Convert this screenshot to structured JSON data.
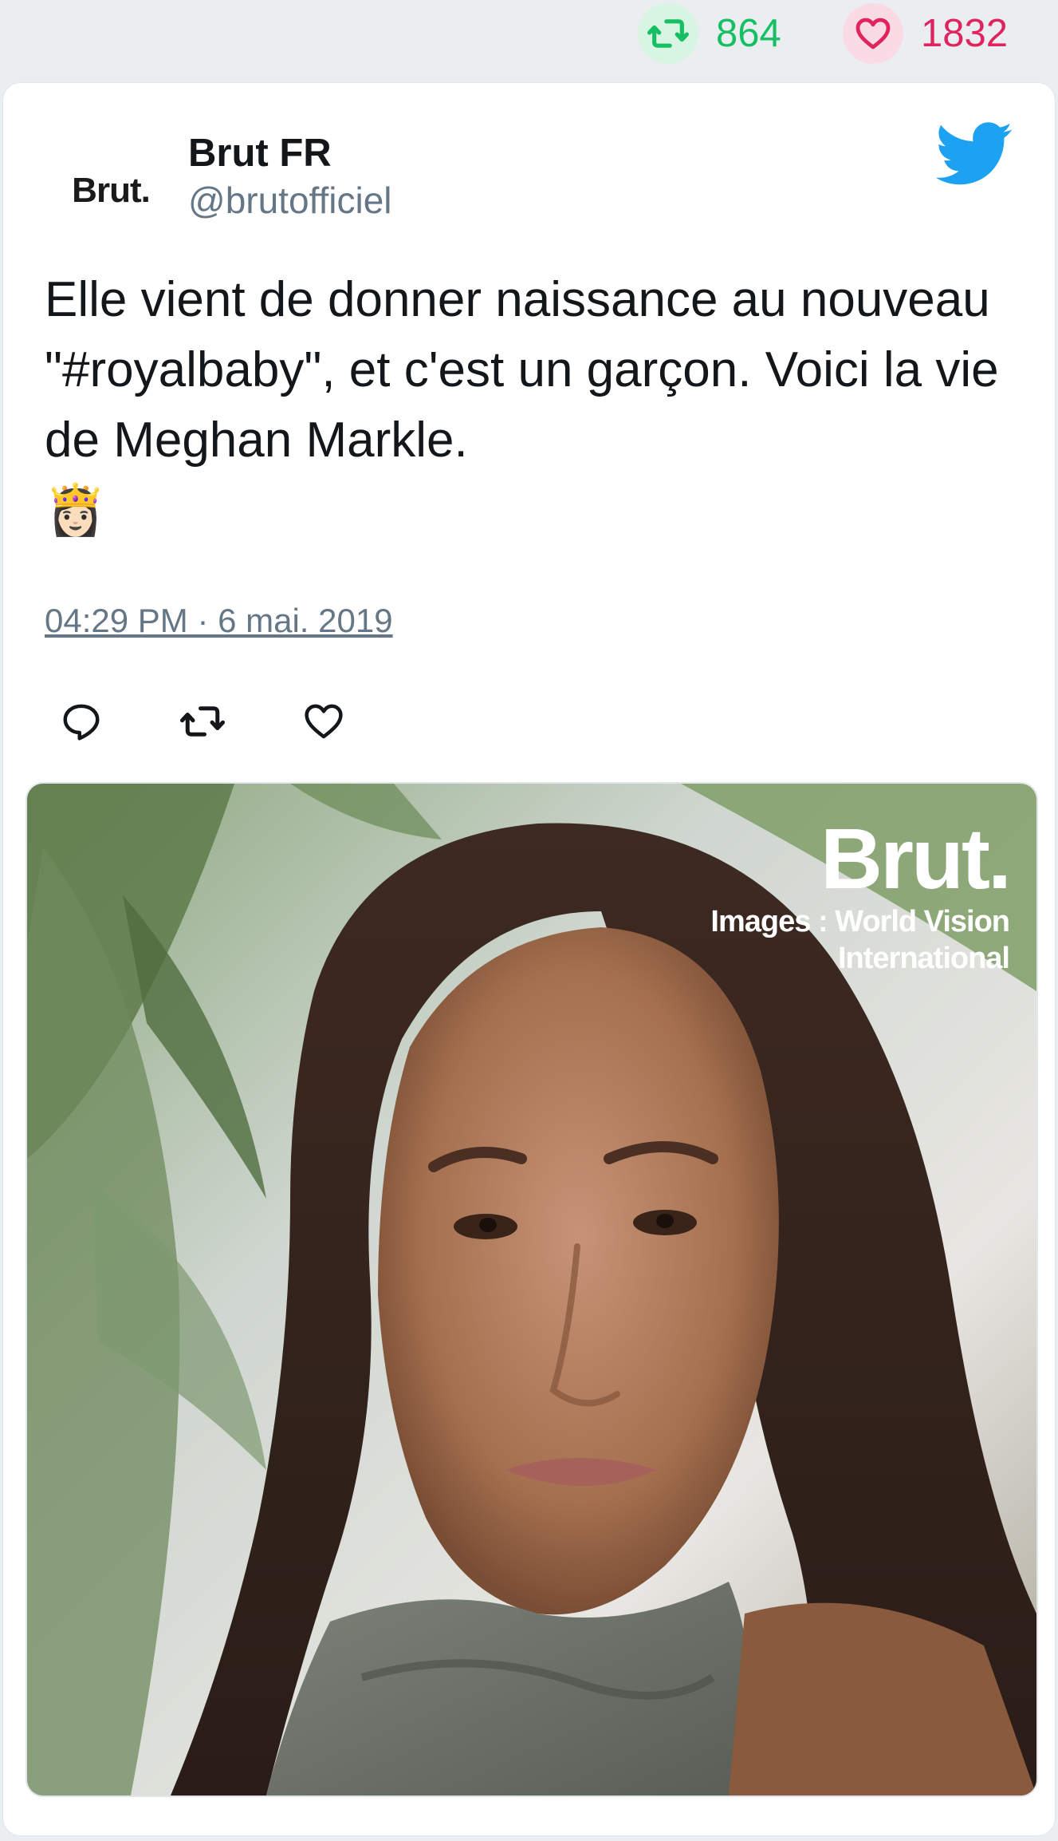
{
  "stats": {
    "retweets": "864",
    "likes": "1832",
    "retweet_color": "#17bf63",
    "like_color": "#e0245e"
  },
  "author": {
    "avatar_text": "Brut.",
    "display_name": "Brut FR",
    "handle": "@brutofficiel"
  },
  "tweet": {
    "text": "Elle vient de donner naissance au nouveau \"#royalbaby\", et c'est un garçon. Voici la vie de Meghan Markle.",
    "emoji": "👸🏻",
    "timestamp": "04:29 PM · 6 mai. 2019"
  },
  "actions": {
    "icons": [
      "reply-icon",
      "retweet-icon",
      "like-icon"
    ]
  },
  "media": {
    "watermark_brand": "Brut.",
    "watermark_credit_line1": "Images : World Vision",
    "watermark_credit_line2": "International"
  },
  "brand": {
    "twitter_color": "#1da1f2"
  }
}
